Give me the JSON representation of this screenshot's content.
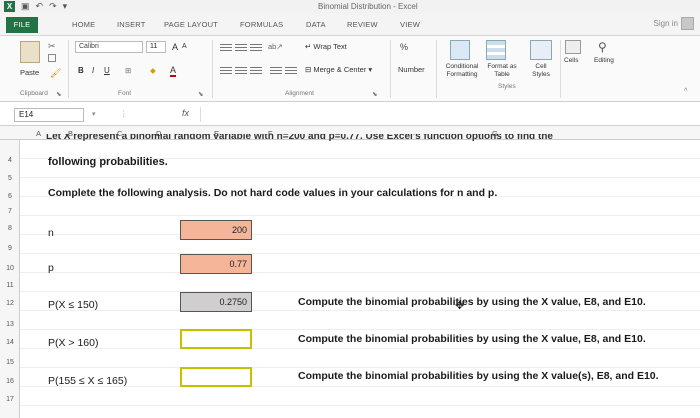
{
  "window": {
    "title": "Binomial Distribution - Excel",
    "signin": "Sign in"
  },
  "ribbon_tabs": [
    "FILE",
    "HOME",
    "INSERT",
    "PAGE LAYOUT",
    "FORMULAS",
    "DATA",
    "REVIEW",
    "VIEW"
  ],
  "ribbon": {
    "paste": "Paste",
    "font_name": "Calibri",
    "font_size": "11",
    "bold": "B",
    "italic": "I",
    "underline": "U",
    "grow_font": "A",
    "shrink_font": "A",
    "font_color": "A",
    "wrap_text": "Wrap Text",
    "merge_center": "Merge & Center",
    "number_format": "Number",
    "percent": "%",
    "conditional_formatting": "Conditional Formatting",
    "format_as_table": "Format as Table",
    "cell_styles": "Cell Styles",
    "cells": "Cells",
    "editing": "Editing",
    "groups": {
      "clipboard": "Clipboard",
      "font": "Font",
      "alignment": "Alignment",
      "styles": "Styles"
    }
  },
  "formula_bar": {
    "name_box": "E14",
    "fx": "fx",
    "content": ""
  },
  "columns": [
    "A",
    "B",
    "C",
    "D",
    "E",
    "F",
    "G"
  ],
  "rows": [
    "4",
    "5",
    "6",
    "7",
    "8",
    "9",
    "10",
    "11",
    "12",
    "13",
    "14",
    "15",
    "16",
    "17"
  ],
  "sheet": {
    "cut_off_line": "Let X represent a binomial random variable with n=200 and p=0.77. Use Excel's function options to find the",
    "intro": "following probabilities.",
    "instruction": "Complete the following analysis. Do not hard code values in your calculations for n and p.",
    "n_label": "n",
    "n_value": "200",
    "p_label": "p",
    "p_value": "0.77",
    "r12_label": "P(X ≤ 150)",
    "r12_value": "0.2750",
    "r12_note": "Compute the binomial probabilities by using the X value, E8, and E10.",
    "r14_label": "P(X > 160)",
    "r14_value": "",
    "r14_note": "Compute the binomial probabilities by using the X value, E8, and E10.",
    "r16_label": "P(155 ≤ X ≤ 165)",
    "r16_value": "",
    "r16_note": "Compute the binomial probabilities by using the X value(s), E8, and E10."
  },
  "colors": {
    "excel_green": "#217346",
    "input_orange": "#f4b599",
    "result_gray": "#d0cece",
    "answer_border": "#c7c000"
  }
}
